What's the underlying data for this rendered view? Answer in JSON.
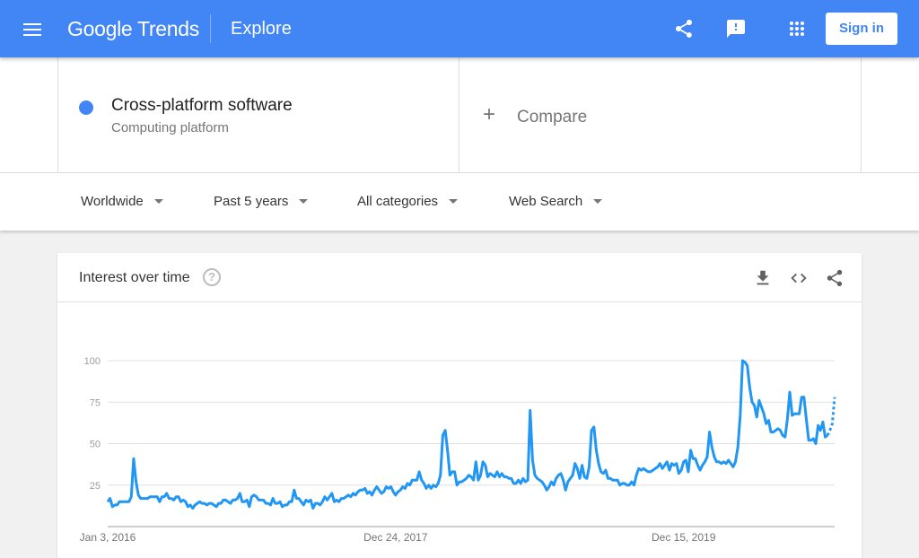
{
  "header": {
    "app_name": "Google Trends",
    "page": "Explore",
    "sign_in_label": "Sign in",
    "icons": [
      "menu-icon",
      "share-icon",
      "feedback-icon",
      "apps-icon"
    ]
  },
  "search": {
    "term": {
      "name": "Cross-platform software",
      "subtitle": "Computing platform",
      "color": "#4285f4"
    },
    "compare_label": "Compare",
    "compare_icon": "+"
  },
  "filters": {
    "region": "Worldwide",
    "time": "Past 5 years",
    "category": "All categories",
    "search_type": "Web Search"
  },
  "card": {
    "title": "Interest over time",
    "help_icon": "?",
    "actions": [
      "download-icon",
      "embed-icon",
      "share-icon"
    ]
  },
  "chart_data": {
    "type": "line",
    "title": "Interest over time",
    "xlabel": "",
    "ylabel": "",
    "ylim": [
      0,
      100
    ],
    "yticks": [
      25,
      50,
      75,
      100
    ],
    "xtick_labels": [
      "Jan 3, 2016",
      "Dec 24, 2017",
      "Dec 15, 2019"
    ],
    "grid": true,
    "legend": "none",
    "series": [
      {
        "name": "Cross-platform software",
        "color": "#2196f3",
        "partial_last_points": 3,
        "values": [
          15,
          17,
          12,
          13,
          13,
          15,
          15,
          15,
          15,
          15,
          18,
          41,
          27,
          19,
          17,
          17,
          17,
          17,
          18,
          18,
          18,
          18,
          15,
          18,
          18,
          20,
          17,
          17,
          16,
          18,
          18,
          15,
          16,
          15,
          12,
          13,
          11,
          13,
          14,
          15,
          14,
          14,
          13,
          14,
          14,
          13,
          12,
          14,
          14,
          16,
          16,
          15,
          14,
          16,
          16,
          17,
          20,
          15,
          15,
          16,
          12,
          18,
          19,
          18,
          16,
          16,
          16,
          14,
          14,
          13,
          17,
          14,
          14,
          15,
          12,
          13,
          13,
          15,
          15,
          22,
          17,
          17,
          15,
          13,
          16,
          15,
          16,
          11,
          14,
          14,
          13,
          15,
          18,
          16,
          18,
          20,
          15,
          16,
          15,
          17,
          17,
          18,
          19,
          18,
          20,
          19,
          21,
          22,
          22,
          23,
          20,
          21,
          19,
          22,
          24,
          22,
          20,
          21,
          24,
          23,
          24,
          21,
          19,
          21,
          22,
          24,
          23,
          26,
          25,
          28,
          28,
          28,
          33,
          28,
          26,
          23,
          25,
          23,
          25,
          24,
          26,
          31,
          55,
          58,
          46,
          31,
          33,
          33,
          25,
          27,
          27,
          28,
          29,
          31,
          30,
          28,
          39,
          28,
          31,
          39,
          37,
          30,
          32,
          31,
          30,
          33,
          30,
          32,
          30,
          30,
          29,
          29,
          26,
          26,
          28,
          26,
          29,
          27,
          28,
          70,
          40,
          31,
          29,
          28,
          27,
          25,
          22,
          24,
          27,
          25,
          29,
          31,
          32,
          28,
          22,
          27,
          29,
          31,
          38,
          35,
          29,
          37,
          30,
          29,
          36,
          58,
          60,
          46,
          38,
          33,
          32,
          34,
          29,
          29,
          28,
          28,
          28,
          25,
          26,
          26,
          25,
          25,
          27,
          25,
          31,
          35,
          34,
          35,
          34,
          33,
          33,
          34,
          35,
          36,
          38,
          35,
          37,
          39,
          34,
          38,
          37,
          38,
          32,
          34,
          39,
          40,
          33,
          46,
          41,
          41,
          37,
          34,
          37,
          39,
          42,
          57,
          48,
          42,
          39,
          39,
          38,
          39,
          38,
          40,
          38,
          36,
          39,
          48,
          67,
          100,
          99,
          97,
          84,
          75,
          73,
          66,
          76,
          72,
          68,
          62,
          64,
          57,
          57,
          58,
          59,
          58,
          55,
          54,
          65,
          81,
          67,
          68,
          68,
          68,
          78,
          78,
          65,
          52,
          52,
          53,
          50,
          61,
          58,
          63,
          54,
          55,
          58,
          62,
          78
        ]
      }
    ]
  }
}
